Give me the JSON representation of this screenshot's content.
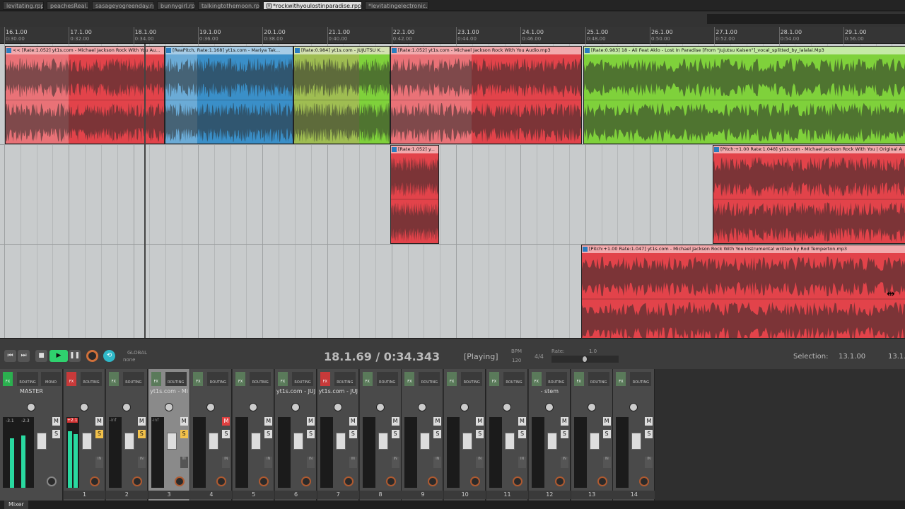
{
  "tabs": [
    {
      "label": "levitating.rpp",
      "active": false
    },
    {
      "label": "peachesReal.rpp",
      "active": false
    },
    {
      "label": "sasageyogreenday.rpp",
      "active": false
    },
    {
      "label": "bunnygirl.rpp",
      "active": false
    },
    {
      "label": "talkingtothemoon.rpp",
      "active": false
    },
    {
      "label": "*rockwithyoulostinparadise.rpp",
      "active": true
    },
    {
      "label": "*levitatingelectronic.rpp",
      "active": false
    }
  ],
  "ruler": [
    {
      "bar": "16.1.00",
      "time": "0:30.00"
    },
    {
      "bar": "17.1.00",
      "time": "0:32.00"
    },
    {
      "bar": "18.1.00",
      "time": "0:34.00"
    },
    {
      "bar": "19.1.00",
      "time": "0:36.00"
    },
    {
      "bar": "20.1.00",
      "time": "0:38.00"
    },
    {
      "bar": "21.1.00",
      "time": "0:40.00"
    },
    {
      "bar": "22.1.00",
      "time": "0:42.00"
    },
    {
      "bar": "23.1.00",
      "time": "0:44.00"
    },
    {
      "bar": "24.1.00",
      "time": "0:46.00"
    },
    {
      "bar": "25.1.00",
      "time": "0:48.00"
    },
    {
      "bar": "26.1.00",
      "time": "0:50.00"
    },
    {
      "bar": "27.1.00",
      "time": "0:52.00"
    },
    {
      "bar": "28.1.00",
      "time": "0:54.00"
    },
    {
      "bar": "29.1.00",
      "time": "0:56.00"
    }
  ],
  "items": {
    "a1": "<< [Rate:1.052] yt1s.com - Michael Jackson  Rock With You Au...",
    "a2": "[ReaPitch, Rate:1.168] yt1s.com - Mariya Tak...",
    "a3": "[Rate:0.984] yt1s.com - JUJUTSU K...",
    "a4": "[Rate:1.052] yt1s.com - Michael Jackson  Rock With You Audio.mp3",
    "a5": "[Rate:0.983] 18 - Ali Feat Aklo - Lost In Paradise [From \"Jujutsu Kaisen\"]_vocal_splitted_by_lalalai.Mp3",
    "b1": "[Rate:1.052] y...",
    "b2": "[Pitch:+1.00 Rate:1.048] yt1s.com - Michael Jackson Rock With You | Original A",
    "c1": "[Pitch:+1.00 Rate:1.047] yt1s.com - Michael Jackson  Rock With You  Instrumental  written by Rod Temperton.mp3"
  },
  "transport": {
    "global_label": "GLOBAL",
    "global_value": "none",
    "position": "18.1.69 / 0:34.343",
    "status": "[Playing]",
    "bpm_label": "BPM",
    "bpm": "120",
    "timesig": "4/4",
    "rate_label": "Rate:",
    "rate": "1.0",
    "selection_label": "Selection:",
    "selection_start": "13.1.00",
    "selection_end": "13.1."
  },
  "mixer": {
    "tab_label": "Mixer",
    "master": {
      "name": "MASTER",
      "mono": "MONO",
      "routing": "ROUTING",
      "peak_l": "-3.1",
      "peak_r": "-2.3"
    },
    "tracks": [
      {
        "num": "1",
        "name": "",
        "fx": "red",
        "mute": false,
        "solo": true,
        "peak": "+2.1"
      },
      {
        "num": "2",
        "name": "",
        "fx": "off",
        "mute": false,
        "solo": true,
        "peak": "-inf"
      },
      {
        "num": "3",
        "name": "yt1s.com - Mi",
        "fx": "off",
        "mute": false,
        "solo": true,
        "peak": "-inf",
        "selected": true
      },
      {
        "num": "4",
        "name": "",
        "fx": "off",
        "mute": true,
        "solo": false,
        "peak": ""
      },
      {
        "num": "5",
        "name": "",
        "fx": "off",
        "mute": false,
        "solo": false,
        "peak": ""
      },
      {
        "num": "6",
        "name": "yt1s.com - JUJ",
        "fx": "off",
        "mute": false,
        "solo": false,
        "peak": ""
      },
      {
        "num": "7",
        "name": "yt1s.com - JUJ",
        "fx": "red",
        "mute": false,
        "solo": false,
        "peak": ""
      },
      {
        "num": "8",
        "name": "",
        "fx": "off",
        "mute": false,
        "solo": false,
        "peak": ""
      },
      {
        "num": "9",
        "name": "",
        "fx": "off",
        "mute": false,
        "solo": false,
        "peak": ""
      },
      {
        "num": "10",
        "name": "",
        "fx": "off",
        "mute": false,
        "solo": false,
        "peak": ""
      },
      {
        "num": "11",
        "name": "",
        "fx": "off",
        "mute": false,
        "solo": false,
        "peak": ""
      },
      {
        "num": "12",
        "name": "- stem",
        "fx": "off",
        "mute": false,
        "solo": false,
        "peak": ""
      },
      {
        "num": "13",
        "name": "",
        "fx": "off",
        "mute": false,
        "solo": false,
        "peak": ""
      },
      {
        "num": "14",
        "name": "",
        "fx": "off",
        "mute": false,
        "solo": false,
        "peak": ""
      }
    ],
    "labels": {
      "fx": "FX",
      "routing": "ROUTING",
      "m": "M",
      "s": "S",
      "in": "IN"
    }
  }
}
